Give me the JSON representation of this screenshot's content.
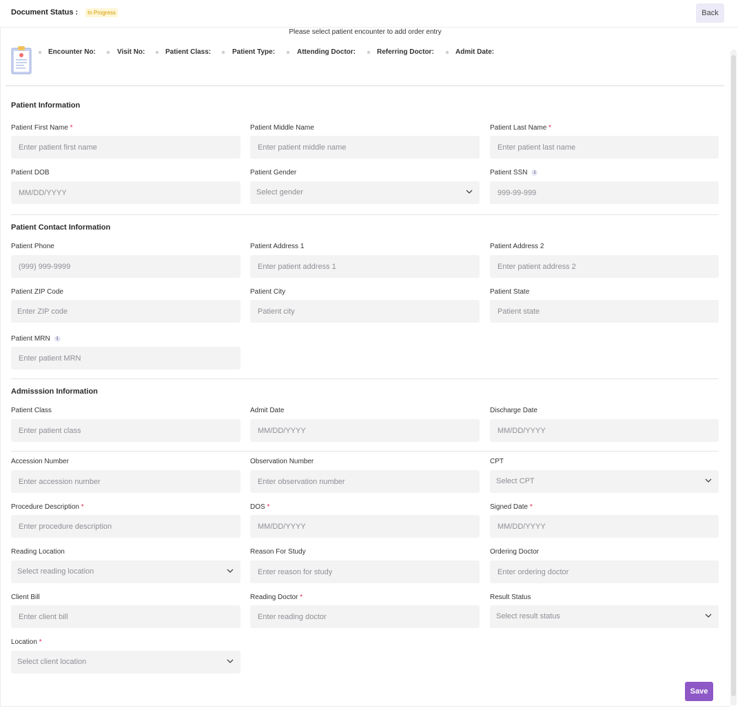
{
  "header": {
    "document_status_label": "Document Status :",
    "status_badge": "In Progress",
    "back_label": "Back",
    "status_badge_color": "#d29b00",
    "accent_color": "#8e59c7"
  },
  "encounter": {
    "message": "Please select patient encounter to add order entry",
    "icon": "clipboard-icon",
    "items": [
      "Encounter No:",
      "Visit No:",
      "Patient Class:",
      "Patient Type:",
      "Attending Doctor:",
      "Referring Doctor:",
      "Admit Date:"
    ]
  },
  "sections": {
    "patient_info": "Patient Information",
    "contact_info": "Patient Contact Information",
    "admission_info": "Admisssion Information"
  },
  "fields": {
    "first_name": {
      "label": "Patient First Name",
      "placeholder": "Enter patient first name"
    },
    "middle_name": {
      "label": "Patient Middle Name",
      "placeholder": "Enter patient middle name"
    },
    "last_name": {
      "label": "Patient Last Name",
      "placeholder": "Enter patient last name"
    },
    "dob": {
      "label": "Patient DOB",
      "placeholder": "MM/DD/YYYY"
    },
    "gender": {
      "label": "Patient Gender",
      "placeholder": "Select gender"
    },
    "ssn": {
      "label": "Patient SSN",
      "placeholder": "999-99-999"
    },
    "phone": {
      "label": "Patient Phone",
      "placeholder": "(999) 999-9999"
    },
    "address1": {
      "label": "Patient Address 1",
      "placeholder": "Enter patient address 1"
    },
    "address2": {
      "label": "Patient Address 2",
      "placeholder": "Enter patient address 2"
    },
    "zip": {
      "label": "Patient ZIP Code",
      "placeholder": "Enter ZIP code"
    },
    "city": {
      "label": "Patient City",
      "placeholder": "Patient city"
    },
    "state": {
      "label": "Patient State",
      "placeholder": "Patient state"
    },
    "mrn": {
      "label": "Patient MRN",
      "placeholder": "Enter patient MRN"
    },
    "patient_class": {
      "label": "Patient Class",
      "placeholder": "Enter patient class"
    },
    "admit_date": {
      "label": "Admit Date",
      "placeholder": "MM/DD/YYYY"
    },
    "discharge_date": {
      "label": "Discharge Date",
      "placeholder": "MM/DD/YYYY"
    },
    "accession": {
      "label": "Accession Number",
      "placeholder": "Enter accession number"
    },
    "observation": {
      "label": "Observation Number",
      "placeholder": "Enter observation number"
    },
    "cpt": {
      "label": "CPT",
      "placeholder": "Select CPT"
    },
    "procedure": {
      "label": "Procedure Description",
      "placeholder": "Enter procedure description"
    },
    "dos": {
      "label": "DOS",
      "placeholder": "MM/DD/YYYY"
    },
    "signed_date": {
      "label": "Signed Date",
      "placeholder": "MM/DD/YYYY"
    },
    "reading_location": {
      "label": "Reading Location",
      "placeholder": "Select reading location"
    },
    "reason": {
      "label": "Reason For Study",
      "placeholder": "Enter reason for study"
    },
    "ordering_doctor": {
      "label": "Ordering Doctor",
      "placeholder": "Enter ordering doctor"
    },
    "client_bill": {
      "label": "Client Bill",
      "placeholder": "Enter client bill"
    },
    "reading_doctor": {
      "label": "Reading Doctor",
      "placeholder": "Enter reading doctor"
    },
    "result_status": {
      "label": "Result Status",
      "placeholder": "Select result status"
    },
    "location": {
      "label": "Location",
      "placeholder": "Select client location"
    }
  },
  "required_marker": "*",
  "info_icon": "i",
  "save_label": "Save"
}
